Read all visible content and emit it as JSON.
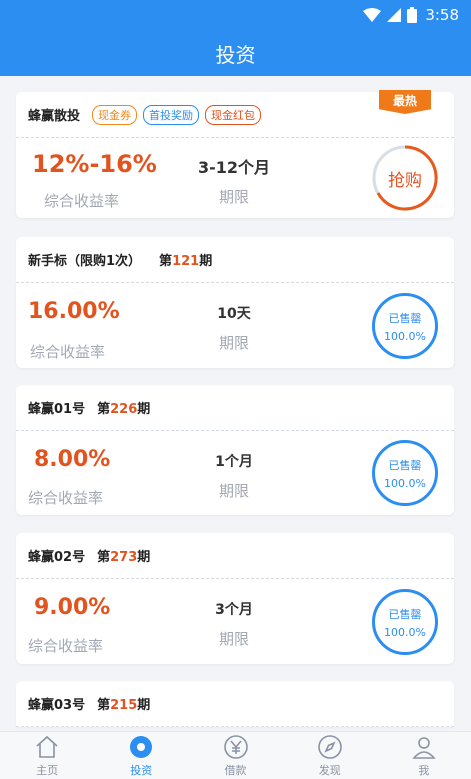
{
  "status_bar": {
    "time": "3:58"
  },
  "app_bar": {
    "title": "投资"
  },
  "featured": {
    "name": "蜂赢散投",
    "tags": [
      "现金券",
      "首投奖励",
      "现金红包"
    ],
    "badge": "最热",
    "rate": "12%-16%",
    "rate_label": "综合收益率",
    "term": "3-12个月",
    "term_label": "期限",
    "action": "抢购"
  },
  "products": [
    {
      "name": "新手标（限购1次）",
      "period_prefix": "第",
      "period_num": "121",
      "period_suffix": "期",
      "rate": "16.00%",
      "rate_label": "综合收益率",
      "term": "10天",
      "term_label": "期限",
      "status": "已售罄",
      "progress": "100.0%"
    },
    {
      "name": "蜂赢01号",
      "period_prefix": "第",
      "period_num": "226",
      "period_suffix": "期",
      "rate": "8.00%",
      "rate_label": "综合收益率",
      "term": "1个月",
      "term_label": "期限",
      "status": "已售罄",
      "progress": "100.0%"
    },
    {
      "name": "蜂赢02号",
      "period_prefix": "第",
      "period_num": "273",
      "period_suffix": "期",
      "rate": "9.00%",
      "rate_label": "综合收益率",
      "term": "3个月",
      "term_label": "期限",
      "status": "已售罄",
      "progress": "100.0%"
    },
    {
      "name": "蜂赢03号",
      "period_prefix": "第",
      "period_num": "215",
      "period_suffix": "期"
    }
  ],
  "tabs": [
    {
      "label": "主页",
      "icon": "home-icon"
    },
    {
      "label": "投资",
      "icon": "invest-icon",
      "active": true
    },
    {
      "label": "借款",
      "icon": "yen-icon"
    },
    {
      "label": "发现",
      "icon": "compass-icon"
    },
    {
      "label": "我",
      "icon": "user-icon"
    }
  ],
  "colors": {
    "primary": "#2b8ef0",
    "rate": "#e2531e",
    "hot": "#f07a1a"
  }
}
